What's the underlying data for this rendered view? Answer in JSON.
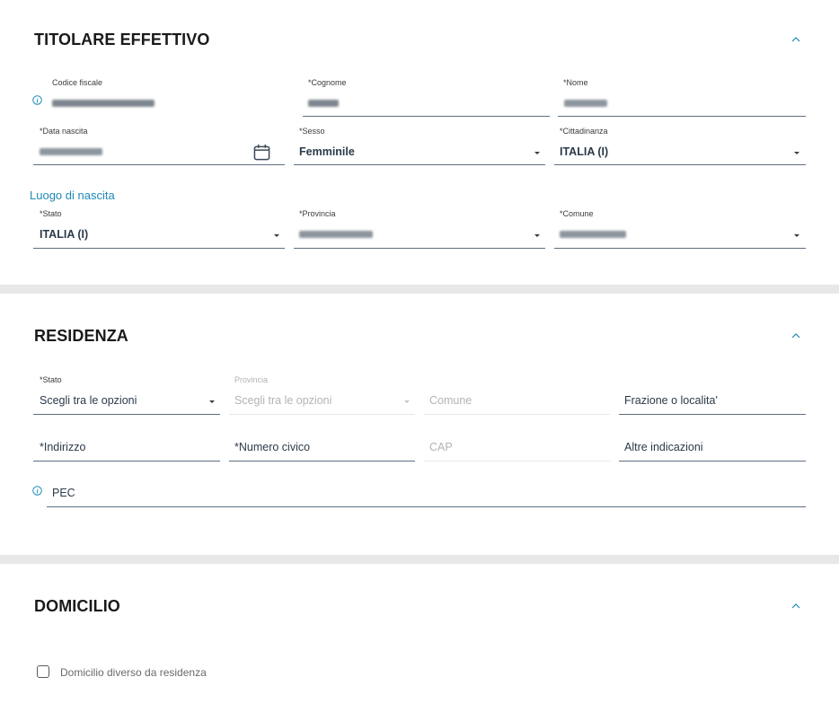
{
  "titolare": {
    "title": "TITOLARE EFFETTIVO",
    "codice_fiscale": {
      "label": "Codice fiscale",
      "value": ""
    },
    "cognome": {
      "label": "*Cognome",
      "value": ""
    },
    "nome": {
      "label": "*Nome",
      "value": ""
    },
    "data_nascita": {
      "label": "*Data nascita",
      "value": ""
    },
    "sesso": {
      "label": "*Sesso",
      "value": "Femminile"
    },
    "cittadinanza": {
      "label": "*Cittadinanza",
      "value": "ITALIA (I)"
    },
    "luogo_title": "Luogo di nascita",
    "stato": {
      "label": "*Stato",
      "value": "ITALIA (I)"
    },
    "provincia": {
      "label": "*Provincia",
      "value": ""
    },
    "comune": {
      "label": "*Comune",
      "value": ""
    }
  },
  "residenza": {
    "title": "RESIDENZA",
    "stato": {
      "label": "*Stato",
      "value": "Scegli tra le opzioni"
    },
    "provincia": {
      "label": "Provincia",
      "value": "Scegli tra le opzioni"
    },
    "comune": {
      "placeholder": "Comune"
    },
    "frazione": {
      "placeholder": "Frazione o localita'"
    },
    "indirizzo": {
      "placeholder": "*Indirizzo"
    },
    "numero_civico": {
      "placeholder": "*Numero civico"
    },
    "cap": {
      "placeholder": "CAP"
    },
    "altre_indicazioni": {
      "placeholder": "Altre indicazioni"
    },
    "pec": {
      "placeholder": "PEC"
    }
  },
  "domicilio": {
    "title": "DOMICILIO",
    "checkbox_label": "Domicilio diverso da residenza",
    "checked": false
  },
  "colors": {
    "accent": "#1f8ab8",
    "underline": "#5c6f82",
    "divider": "#e8e8e8"
  }
}
